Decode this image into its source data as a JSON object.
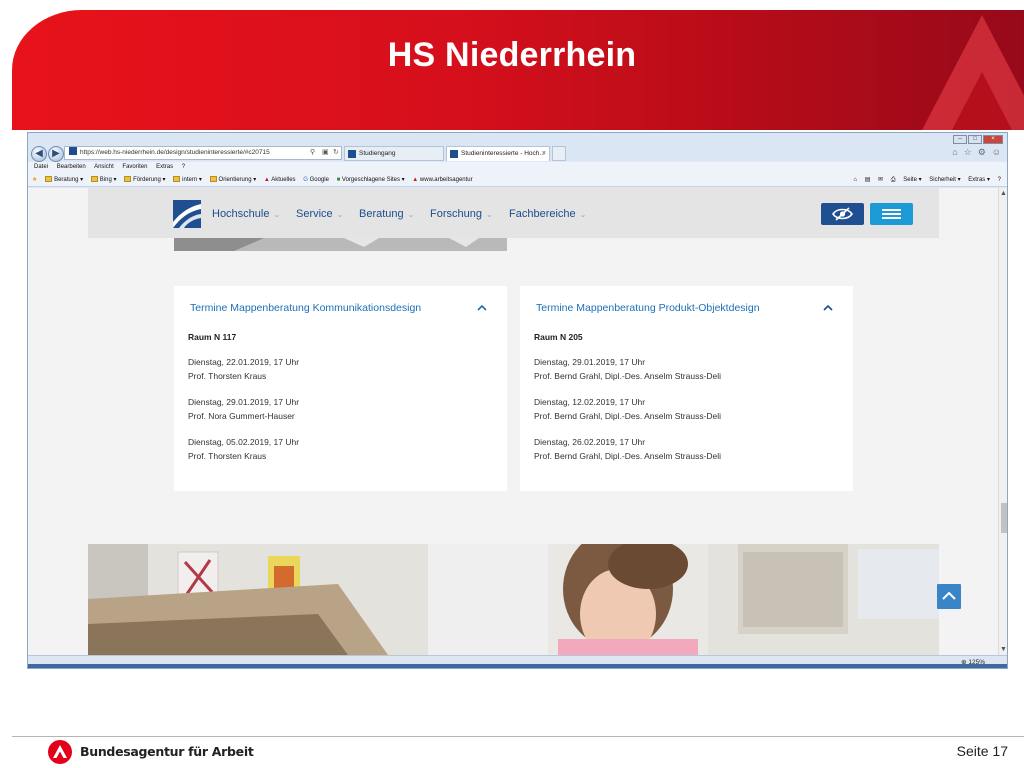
{
  "slide": {
    "title": "HS Niederrhein",
    "footer_org": "Bundesagentur für Arbeit",
    "page_number": "Seite 17"
  },
  "browser": {
    "address": "https://web.hs-niederrhein.de/design/studieninteressierte/#c20715",
    "tabs": [
      "Studiengang",
      "Studieninteressierte - Hoch..."
    ],
    "tab_close": "×",
    "menu": [
      "Datei",
      "Bearbeiten",
      "Ansicht",
      "Favoriten",
      "Extras",
      "?"
    ],
    "favorites": [
      "Beratung ▾",
      "Bing ▾",
      "Förderung ▾",
      "intern ▾",
      "Orientierung ▾",
      "Aktuelles",
      "Google",
      "Vorgeschlagene Sites ▾",
      "www.arbeitsagentur"
    ],
    "command_bar": [
      "Seite ▾",
      "Sicherheit ▾",
      "Extras ▾"
    ],
    "zoom": "125%"
  },
  "site": {
    "nav": [
      "Hochschule",
      "Service",
      "Beratung",
      "Forschung",
      "Fachbereiche"
    ],
    "cards": [
      {
        "title": "Termine Mappenberatung Kommunikationsdesign",
        "room": "Raum N 117",
        "appointments": [
          {
            "date": "Dienstag, 22.01.2019, 17 Uhr",
            "person": "Prof. Thorsten Kraus"
          },
          {
            "date": "Dienstag, 29.01.2019, 17 Uhr",
            "person": "Prof. Nora Gummert-Hauser"
          },
          {
            "date": "Dienstag, 05.02.2019, 17 Uhr",
            "person": "Prof. Thorsten Kraus"
          }
        ]
      },
      {
        "title": "Termine Mappenberatung Produkt-Objektdesign",
        "room": "Raum N 205",
        "appointments": [
          {
            "date": "Dienstag, 29.01.2019, 17 Uhr",
            "person": "Prof. Bernd Grahl, Dipl.-Des. Anselm Strauss-Deli"
          },
          {
            "date": "Dienstag, 12.02.2019, 17 Uhr",
            "person": "Prof. Bernd Grahl, Dipl.-Des. Anselm Strauss-Deli"
          },
          {
            "date": "Dienstag, 26.02.2019, 17 Uhr",
            "person": "Prof. Bernd Grahl, Dipl.-Des. Anselm Strauss-Deli"
          }
        ]
      }
    ]
  },
  "colors": {
    "brand_red": "#e2001a",
    "site_blue": "#1f4f91",
    "link_blue": "#1d6fb8",
    "menu_button": "#1c9ad6"
  },
  "icons": [
    "ba-logo-icon",
    "back-icon",
    "forward-icon",
    "search-icon",
    "refresh-icon",
    "home-icon",
    "star-icon",
    "gear-icon",
    "eye-slash-icon",
    "hamburger-menu-icon",
    "chevron-up-icon",
    "scroll-top-icon"
  ]
}
